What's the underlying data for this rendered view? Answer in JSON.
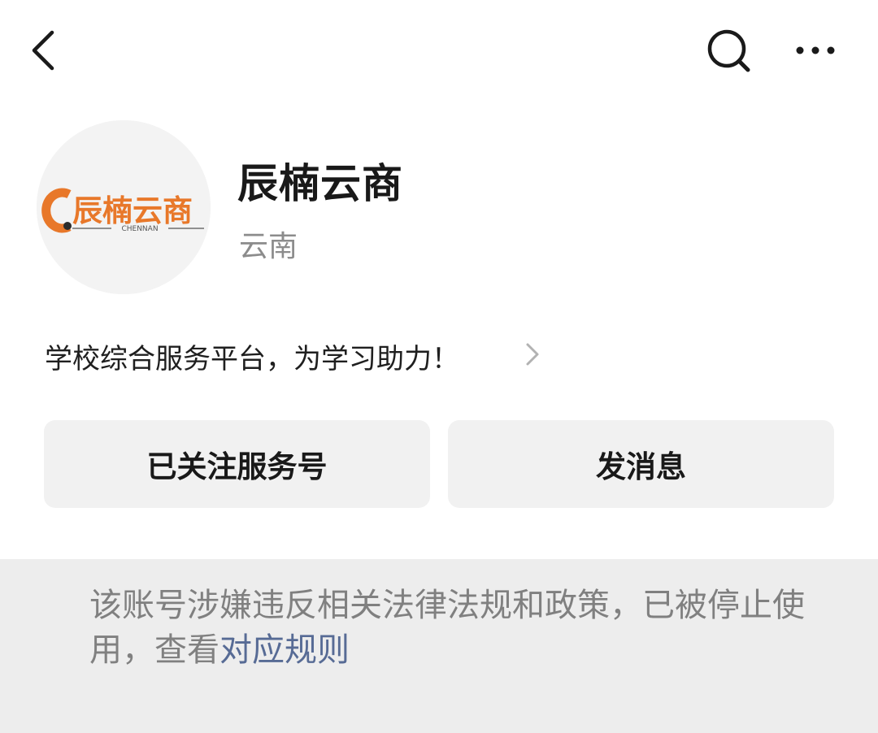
{
  "nav": {
    "back_icon": "chevron-left-icon",
    "search_icon": "search-icon",
    "more_icon": "more-horizontal-icon"
  },
  "profile": {
    "name": "辰楠云商",
    "region": "云南",
    "avatar": {
      "logo_text": "辰楠云商",
      "logo_subtext": "CHENNAN",
      "logo_color": "#e8782a"
    }
  },
  "description": {
    "text": "学校综合服务平台，为学习助力！",
    "chevron_icon": "chevron-right-icon"
  },
  "actions": {
    "follow_label": "已关注服务号",
    "message_label": "发消息"
  },
  "notice": {
    "text": "该账号涉嫌违反相关法律法规和政策，已被停止使用，查看",
    "link_text": "对应规则",
    "link_color": "#576b95"
  }
}
